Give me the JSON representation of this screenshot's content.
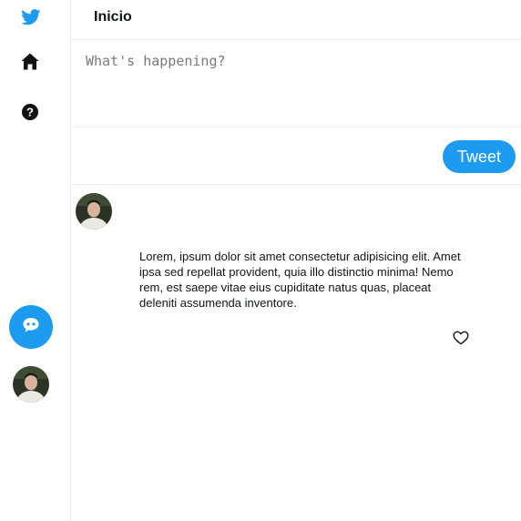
{
  "sidebar": {
    "logo_icon": "twitter-bird-icon",
    "home_icon": "home-icon",
    "help_icon": "question-icon",
    "compose_icon": "chat-bubble-icon",
    "accent_color": "#1d9bf0"
  },
  "header": {
    "title": "Inicio"
  },
  "composer": {
    "placeholder": "What's happening?",
    "tweet_label": "Tweet"
  },
  "feed": {
    "tweets": [
      {
        "text": "Lorem, ipsum dolor sit amet consectetur adipisicing elit. Amet ipsa sed repellat provident, quia illo distinctio minima! Nemo rem, est saepe vitae eius cupiditate natus quas, placeat deleniti assumenda inventore.",
        "like_icon": "heart-outline-icon"
      }
    ]
  }
}
